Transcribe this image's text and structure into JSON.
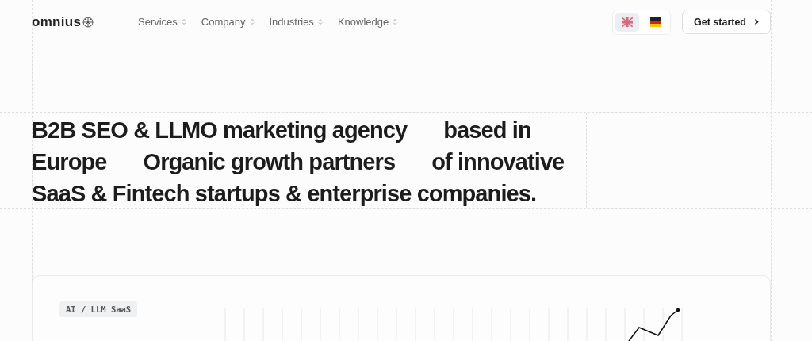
{
  "header": {
    "logo": "omnius",
    "nav": [
      {
        "label": "Services"
      },
      {
        "label": "Company"
      },
      {
        "label": "Industries"
      },
      {
        "label": "Knowledge"
      }
    ],
    "languages": [
      {
        "kind": "uk",
        "selected": true
      },
      {
        "kind": "de",
        "selected": false
      }
    ],
    "cta": "Get started"
  },
  "headline": {
    "lines": [
      [
        "B2B SEO & LLMO marketing agency",
        "based in"
      ],
      [
        "Europe",
        "Organic growth partners",
        "of innovative"
      ],
      [
        "SaaS & Fintech startups & enterprise companies."
      ]
    ]
  },
  "card": {
    "tag": "AI / LLM SaaS"
  }
}
